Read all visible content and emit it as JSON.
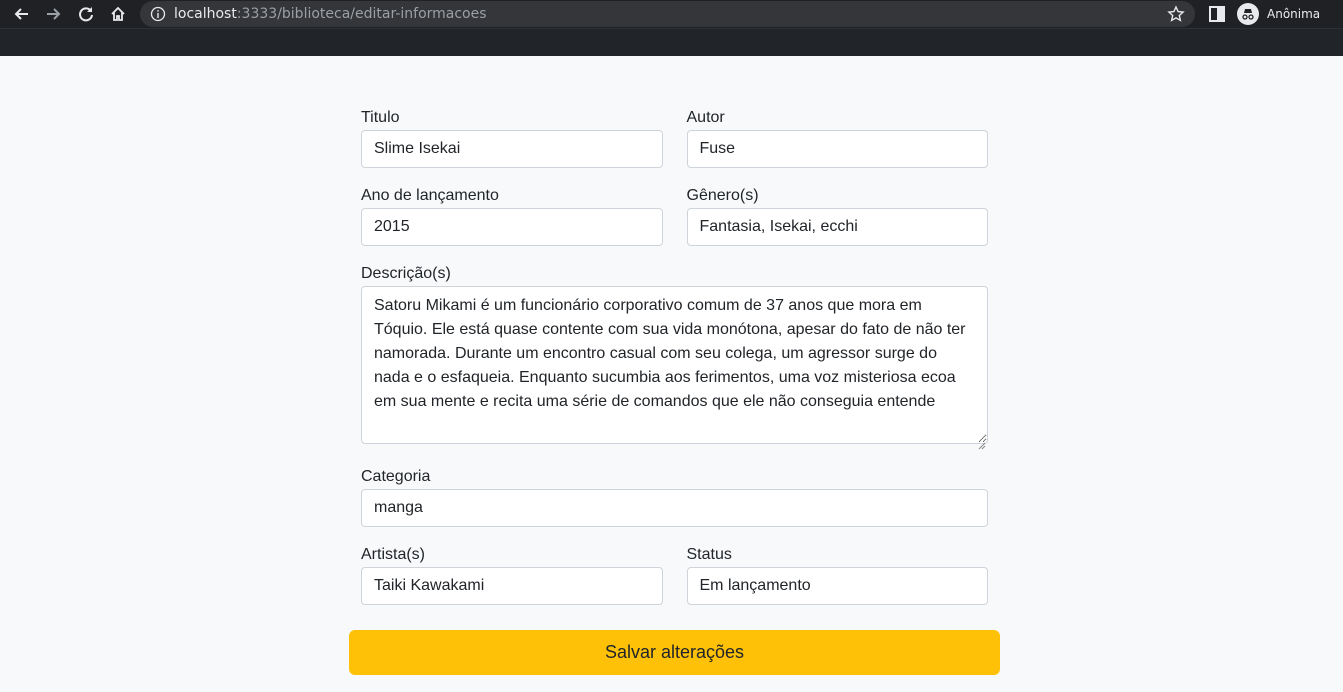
{
  "browser": {
    "url_host": "localhost",
    "url_path": ":3333/biblioteca/editar-informacoes",
    "profile_name": "Anônima",
    "icons": [
      "back-icon",
      "forward-icon",
      "reload-icon",
      "home-icon",
      "site-info-icon",
      "bookmark-star-icon",
      "side-panel-icon",
      "incognito-icon"
    ]
  },
  "form": {
    "titulo_label": "Titulo",
    "titulo_value": "Slime Isekai",
    "autor_label": "Autor",
    "autor_value": "Fuse",
    "ano_label": "Ano de lançamento",
    "ano_value": "2015",
    "genero_label": "Gênero(s)",
    "genero_value": "Fantasia, Isekai, ecchi",
    "descricao_label": "Descrição(s)",
    "descricao_value": "Satoru Mikami é um funcionário corporativo comum de 37 anos que mora em Tóquio. Ele está quase contente com sua vida monótona, apesar do fato de não ter namorada. Durante um encontro casual com seu colega, um agressor surge do nada e o esfaqueia. Enquanto sucumbia aos ferimentos, uma voz misteriosa ecoa em sua mente e recita uma série de comandos que ele não conseguia entende",
    "categoria_label": "Categoria",
    "categoria_value": "manga",
    "artista_label": "Artista(s)",
    "artista_value": "Taiki Kawakami",
    "status_label": "Status",
    "status_value": "Em lançamento",
    "save_label": "Salvar alterações"
  },
  "colors": {
    "chrome_bg": "#202124",
    "omnibox_bg": "#35363a",
    "navbar_bg": "#212529",
    "page_bg": "#f8f9fa",
    "button_bg": "#ffc107"
  }
}
